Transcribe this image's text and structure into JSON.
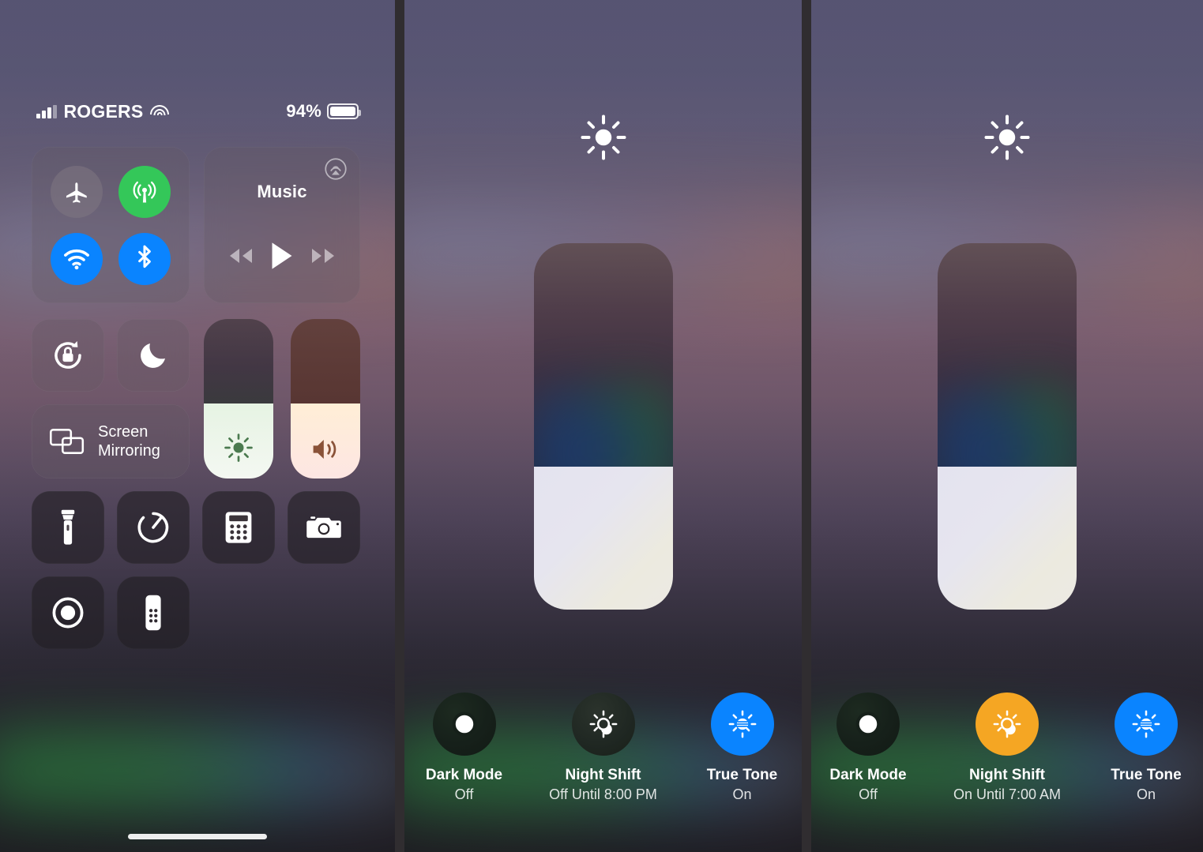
{
  "statusbar": {
    "carrier": "ROGERS",
    "signal_icon": "cellular-bars-icon",
    "wifi_icon": "wifi-icon",
    "battery_percent": "94%",
    "battery_icon": "battery-icon"
  },
  "control_center": {
    "connectivity": {
      "airplane": {
        "label": "Airplane Mode",
        "icon": "airplane-icon",
        "state": "off"
      },
      "cellular": {
        "label": "Cellular Data",
        "icon": "cellular-tower-icon",
        "state": "on",
        "color": "#34c759"
      },
      "wifi": {
        "label": "Wi-Fi",
        "icon": "wifi-icon",
        "state": "on",
        "color": "#0a84ff"
      },
      "bluetooth": {
        "label": "Bluetooth",
        "icon": "bluetooth-icon",
        "state": "on",
        "color": "#0a84ff"
      }
    },
    "media": {
      "title": "Music",
      "airplay_icon": "airplay-icon",
      "rewind_icon": "rewind-icon",
      "play_icon": "play-icon",
      "forward_icon": "fast-forward-icon"
    },
    "rotation_lock": {
      "label": "Rotation Lock",
      "icon": "rotation-lock-icon"
    },
    "do_not_disturb": {
      "label": "Do Not Disturb",
      "icon": "moon-icon"
    },
    "screen_mirroring": {
      "line1": "Screen",
      "line2": "Mirroring",
      "icon": "screen-mirroring-icon"
    },
    "brightness_mini": {
      "label": "Brightness",
      "icon": "brightness-sun-icon",
      "fill_percent": 47
    },
    "volume_mini": {
      "label": "Volume",
      "icon": "speaker-icon",
      "fill_percent": 47
    },
    "shortcuts": [
      {
        "label": "Flashlight",
        "icon": "flashlight-icon"
      },
      {
        "label": "Timer",
        "icon": "timer-icon"
      },
      {
        "label": "Calculator",
        "icon": "calculator-icon"
      },
      {
        "label": "Camera",
        "icon": "camera-icon"
      },
      {
        "label": "Screen Recording",
        "icon": "screen-record-icon"
      },
      {
        "label": "Apple TV Remote",
        "icon": "tv-remote-icon"
      }
    ],
    "home_indicator": "home-indicator"
  },
  "brightness_sheet_middle": {
    "top_icon": "sun-icon",
    "slider": {
      "label": "Brightness",
      "fill_percent": 39
    },
    "toggles": [
      {
        "name": "Dark Mode",
        "state": "Off",
        "icon": "dark-mode-icon",
        "active": false,
        "color": "#16201a"
      },
      {
        "name": "Night Shift",
        "state": "Off Until 8:00 PM",
        "icon": "night-shift-icon",
        "active": false,
        "color": "#1f2722"
      },
      {
        "name": "True Tone",
        "state": "On",
        "icon": "true-tone-icon",
        "active": true,
        "color": "#0a84ff"
      }
    ]
  },
  "brightness_sheet_right": {
    "top_icon": "sun-icon",
    "slider": {
      "label": "Brightness",
      "fill_percent": 39
    },
    "toggles": [
      {
        "name": "Dark Mode",
        "state": "Off",
        "icon": "dark-mode-icon",
        "active": false,
        "color": "#16201a"
      },
      {
        "name": "Night Shift",
        "state": "On Until 7:00 AM",
        "icon": "night-shift-icon",
        "active": true,
        "color": "#f5a623"
      },
      {
        "name": "True Tone",
        "state": "On",
        "icon": "true-tone-icon",
        "active": true,
        "color": "#0a84ff"
      }
    ]
  }
}
